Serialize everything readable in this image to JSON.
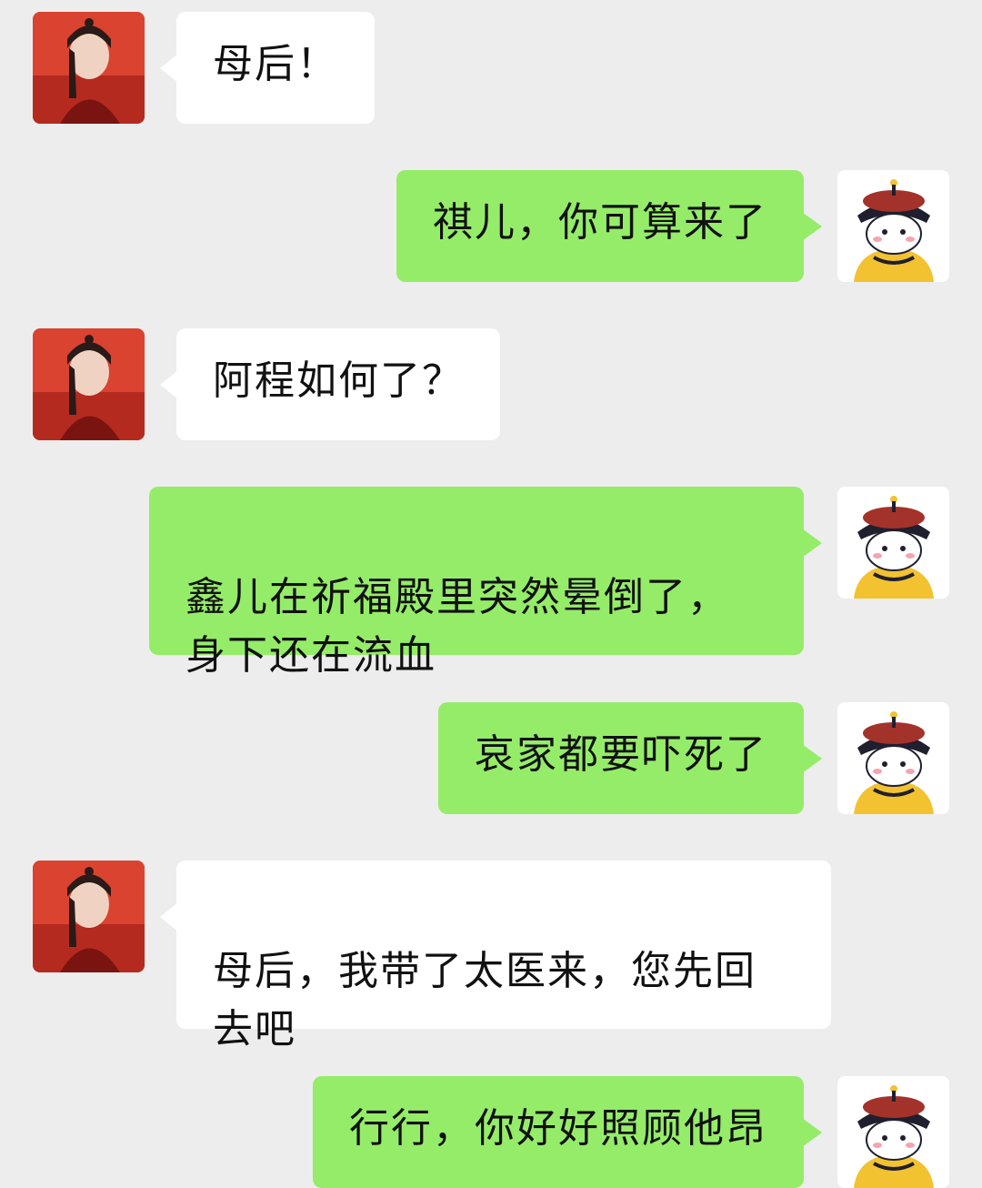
{
  "messages": [
    {
      "side": "left",
      "text": "母后！"
    },
    {
      "side": "right",
      "text": "祺儿，你可算来了"
    },
    {
      "side": "left",
      "text": "阿程如何了？"
    },
    {
      "side": "right",
      "text": "鑫儿在祈福殿里突然晕倒了，\n身下还在流血"
    },
    {
      "side": "right",
      "text": "哀家都要吓死了"
    },
    {
      "side": "left",
      "text": "母后，我带了太医来，您先回\n去吧"
    },
    {
      "side": "right",
      "text": "行行，你好好照顾他昂"
    }
  ],
  "colors": {
    "background": "#ededed",
    "sent_bubble": "#95ec69",
    "received_bubble": "#ffffff",
    "left_avatar": "#d9432f",
    "right_avatar_hat": "#1f1f2e",
    "right_avatar_robe": "#f2c230"
  },
  "avatars": {
    "left": "person-photo-avatar",
    "right": "emperor-cartoon-avatar"
  }
}
